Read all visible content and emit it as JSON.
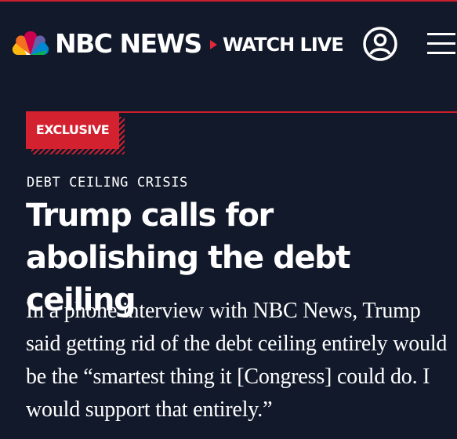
{
  "header": {
    "brand": "NBC NEWS",
    "watch_live_label": "WATCH LIVE",
    "account_icon": "user-circle-icon",
    "menu_icon": "hamburger-menu-icon"
  },
  "article": {
    "badge": "EXCLUSIVE",
    "category": "DEBT CEILING CRISIS",
    "headline": "Trump calls for abolishing the debt ceiling",
    "dek": "In a phone interview with NBC News, Trump said getting rid of the debt ceiling entirely would be the “smartest thing it [Congress] could do. I would support that entirely.”"
  },
  "colors": {
    "background": "#12192b",
    "accent_red": "#d3212f",
    "text": "#ffffff"
  }
}
